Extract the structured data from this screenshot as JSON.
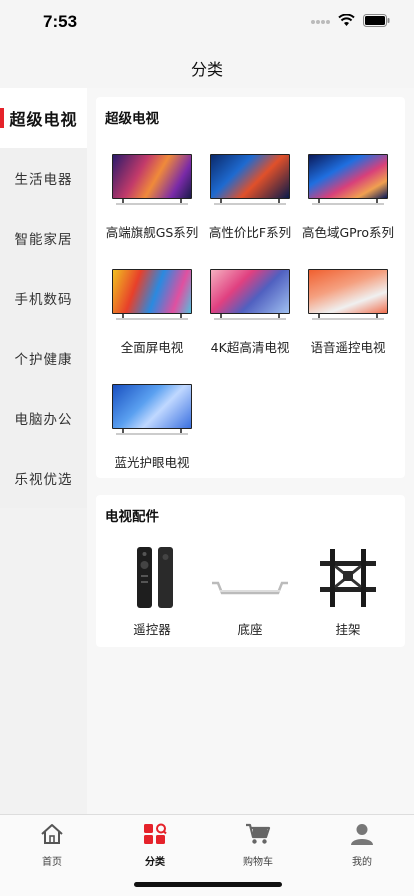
{
  "status_bar": {
    "time": "7:53"
  },
  "nav": {
    "title": "分类"
  },
  "sidebar": {
    "items": [
      {
        "label": "超级电视",
        "active": true
      },
      {
        "label": "生活电器"
      },
      {
        "label": "智能家居"
      },
      {
        "label": "手机数码"
      },
      {
        "label": "个护健康"
      },
      {
        "label": "电脑办公"
      },
      {
        "label": "乐视优选"
      }
    ]
  },
  "sections": [
    {
      "title": "超级电视",
      "items": [
        {
          "label": "高端旗舰GS系列"
        },
        {
          "label": "高性价比F系列"
        },
        {
          "label": "高色域GPro系列"
        },
        {
          "label": "全面屏电视"
        },
        {
          "label": "4K超高清电视"
        },
        {
          "label": "语音遥控电视"
        },
        {
          "label": "蓝光护眼电视"
        }
      ]
    },
    {
      "title": "电视配件",
      "items": [
        {
          "label": "遥控器"
        },
        {
          "label": "底座"
        },
        {
          "label": "挂架"
        }
      ]
    }
  ],
  "tab_bar": {
    "tabs": [
      {
        "label": "首页"
      },
      {
        "label": "分类",
        "active": true
      },
      {
        "label": "购物车"
      },
      {
        "label": "我的"
      }
    ]
  },
  "colors": {
    "accent": "#e5222a"
  }
}
